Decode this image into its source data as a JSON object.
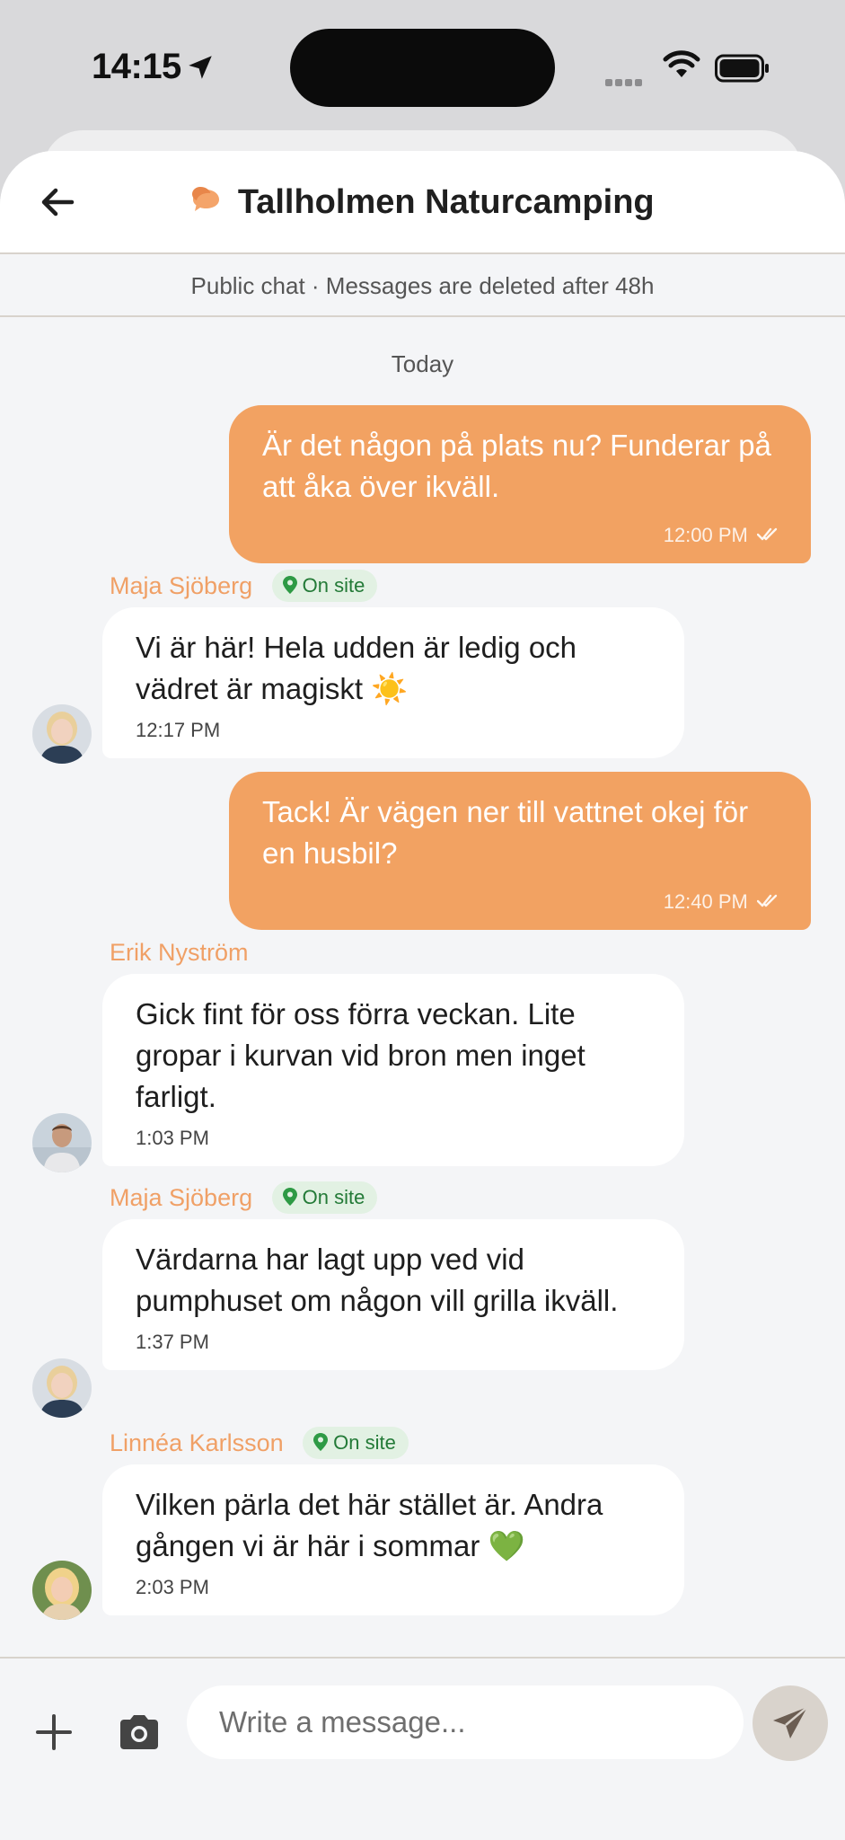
{
  "status_bar": {
    "time": "14:15"
  },
  "header": {
    "title": "Tallholmen Naturcamping",
    "notice": "Public chat · Messages are deleted after 48h",
    "back_icon": "arrow-left-icon",
    "chat_icon": "chat-bubbles-icon"
  },
  "chat": {
    "date_label": "Today",
    "messages": [
      {
        "direction": "outgoing",
        "text": "Är det någon på plats nu? Funderar på att åka över ikväll.",
        "time": "12:00 PM",
        "status": "read"
      },
      {
        "direction": "incoming",
        "sender": "Maja Sjöberg",
        "badge": "On site",
        "text": "Vi är här! Hela udden är ledig och vädret är magiskt ☀️",
        "time": "12:17 PM"
      },
      {
        "direction": "outgoing",
        "text": "Tack! Är vägen ner till vattnet okej för en husbil?",
        "time": "12:40 PM",
        "status": "read"
      },
      {
        "direction": "incoming",
        "sender": "Erik Nyström",
        "text": "Gick fint för oss förra veckan. Lite gropar i kurvan vid bron men inget farligt.",
        "time": "1:03 PM"
      },
      {
        "direction": "incoming",
        "sender": "Maja Sjöberg",
        "badge": "On site",
        "text": "Värdarna har lagt upp ved vid pumphuset om någon vill grilla ikväll.",
        "time": "1:37 PM"
      },
      {
        "direction": "incoming",
        "sender": "Linnéa Karlsson",
        "badge": "On site",
        "text": "Vilken pärla det här stället är. Andra gången vi är här i sommar 💚",
        "time": "2:03 PM"
      }
    ]
  },
  "composer": {
    "placeholder": "Write a message...",
    "plus_icon": "plus-icon",
    "camera_icon": "camera-icon",
    "send_icon": "send-icon"
  },
  "colors": {
    "accent": "#f2a262",
    "sender_name": "#f0a066",
    "onsite_bg": "#e2f1e3",
    "onsite_text": "#237a37",
    "background": "#f4f5f7"
  }
}
